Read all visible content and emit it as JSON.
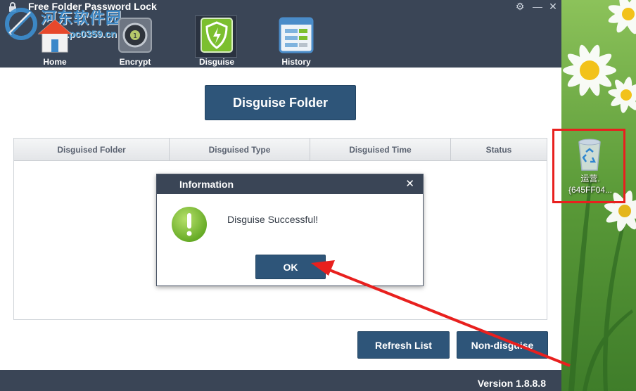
{
  "app": {
    "title": "Free Folder Password Lock",
    "watermark_text": "河东软件园",
    "watermark_url": "www.pc0359.cn"
  },
  "nav": [
    {
      "label": "Home",
      "icon": "home-icon"
    },
    {
      "label": "Encrypt",
      "icon": "safe-icon"
    },
    {
      "label": "Disguise",
      "icon": "shield-icon"
    },
    {
      "label": "History",
      "icon": "list-icon"
    }
  ],
  "main": {
    "disguise_button": "Disguise Folder",
    "columns": [
      "Disguised Folder",
      "Disguised Type",
      "Disguised Time",
      "Status"
    ],
    "refresh_button": "Refresh List",
    "nondisguise_button": "Non-disguise"
  },
  "footer": {
    "version": "Version 1.8.8.8"
  },
  "dialog": {
    "title": "Information",
    "message": "Disguise Successful!",
    "ok_label": "OK",
    "close_glyph": "✕",
    "icon": "exclamation-icon"
  },
  "desktop": {
    "recycle_label_line1": "运营.",
    "recycle_label_line2": "{645FF04..."
  },
  "colors": {
    "titlebar": "#3a4556",
    "button": "#2e5579",
    "annotation": "#e8201e",
    "success_green": "#79bd2e"
  }
}
